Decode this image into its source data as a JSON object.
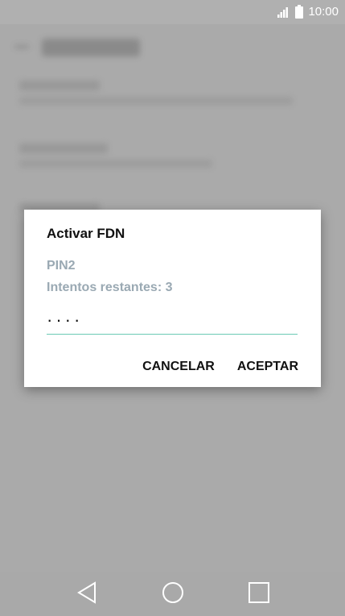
{
  "status_bar": {
    "time": "10:00",
    "signal_icon": "signal-icon",
    "battery_icon": "battery-icon"
  },
  "dialog": {
    "title": "Activar FDN",
    "pin_label": "PIN2",
    "attempts_label": "Intentos restantes: 3",
    "pin_value": "····",
    "cancel_label": "CANCELAR",
    "accept_label": "ACEPTAR",
    "accent_color": "#6cc9b4"
  },
  "nav_bar": {
    "back_icon": "back-icon",
    "home_icon": "home-icon",
    "recents_icon": "recents-icon"
  }
}
